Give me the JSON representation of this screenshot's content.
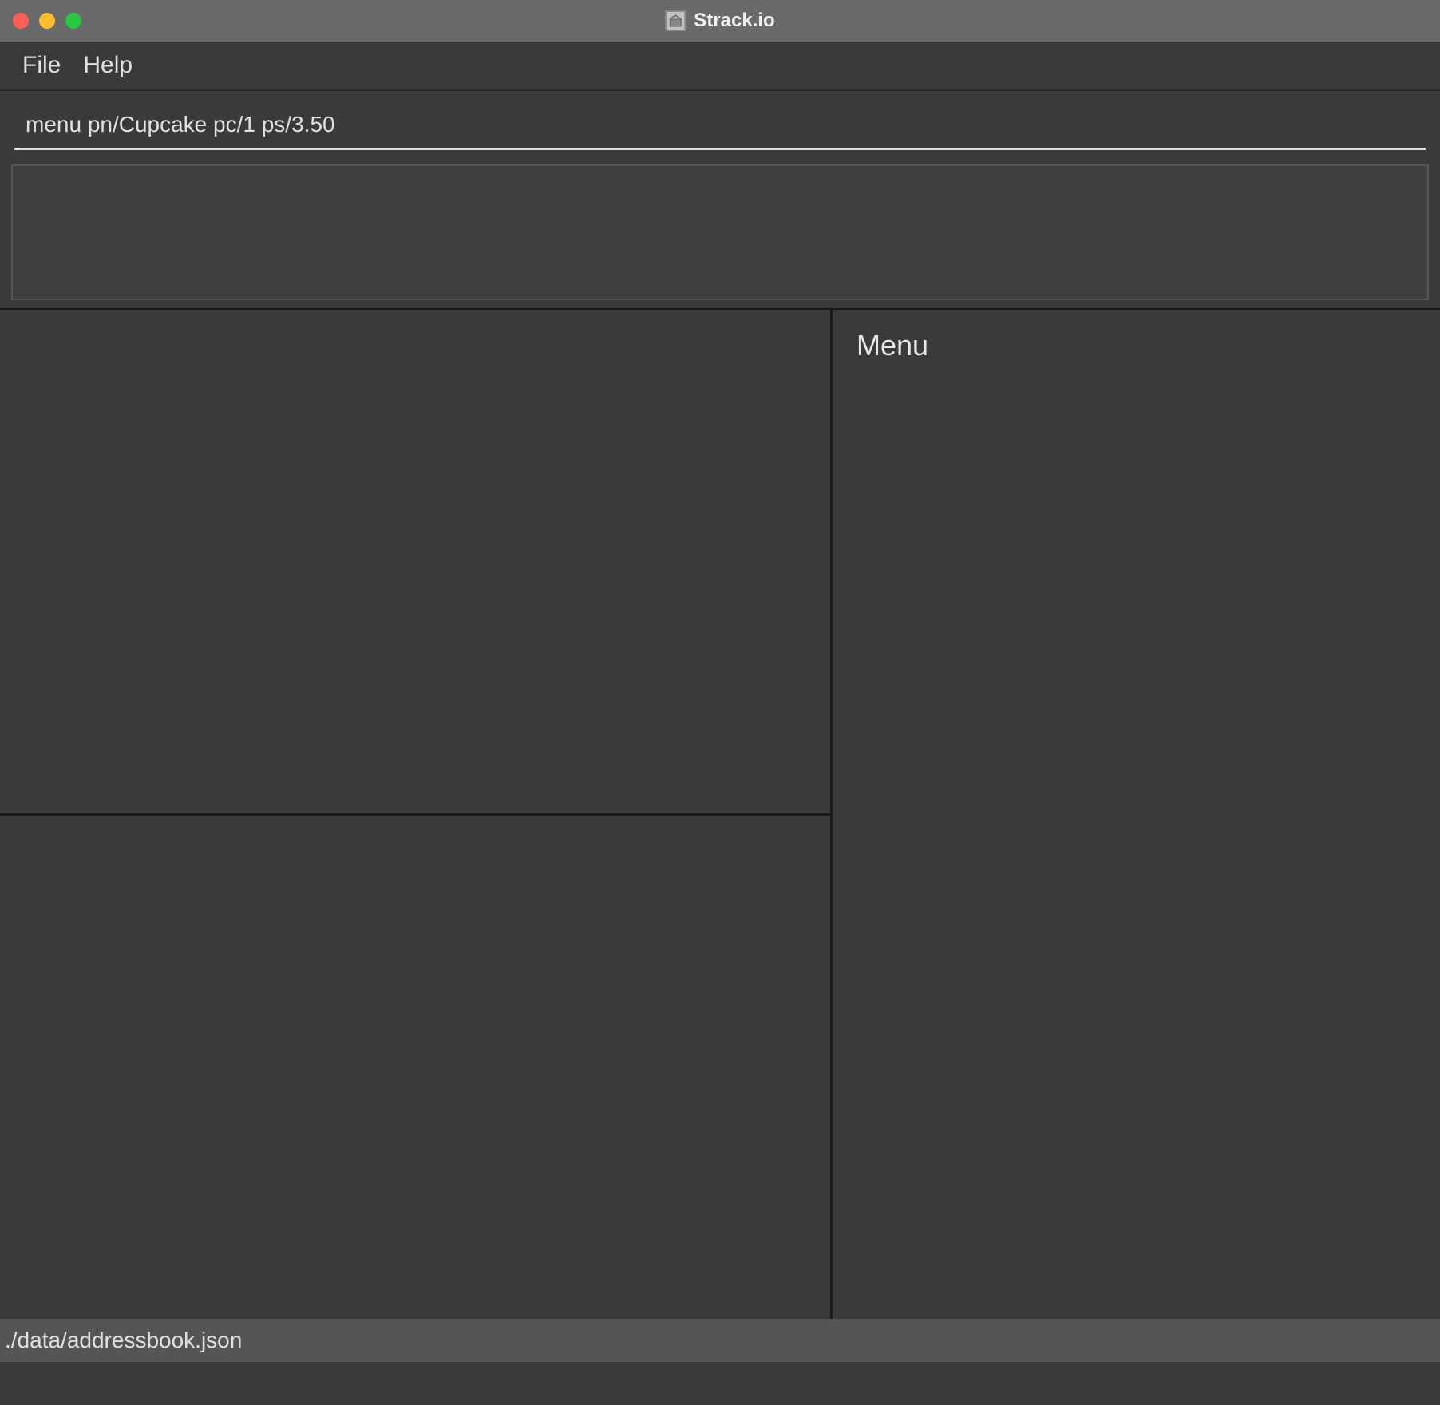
{
  "window": {
    "title": "Strack.io"
  },
  "menubar": {
    "file": "File",
    "help": "Help"
  },
  "command": {
    "value": "menu pn/Cupcake pc/1 ps/3.50"
  },
  "right_panel": {
    "heading": "Menu"
  },
  "statusbar": {
    "path": "./data/addressbook.json"
  }
}
